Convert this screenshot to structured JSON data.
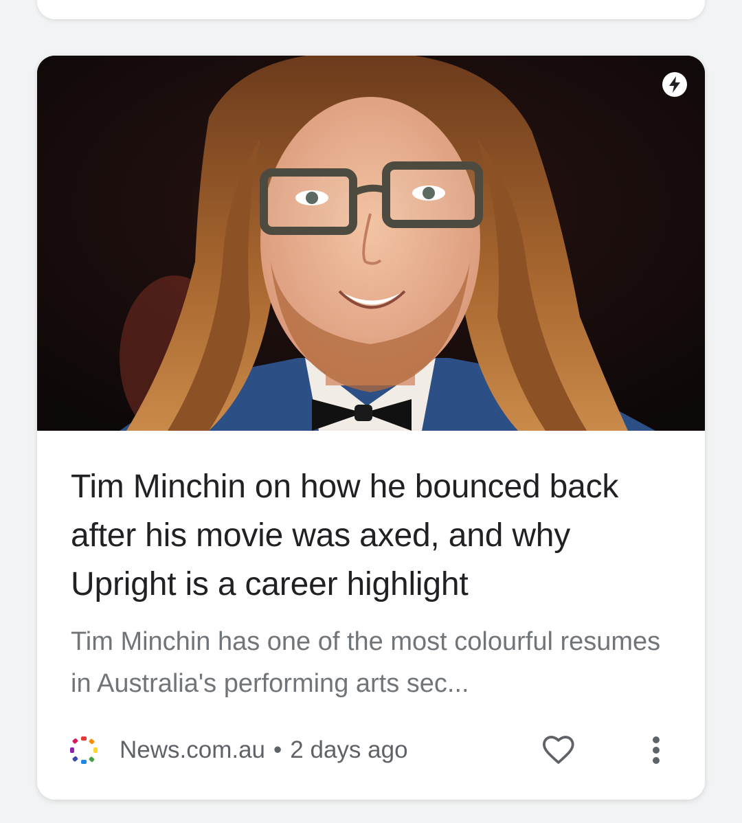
{
  "card": {
    "headline": "Tim Minchin on how he bounced back after his movie was axed, and why Upright is a career highlight",
    "snippet": "Tim Minchin has one of the most colourful resumes in Australia's performing arts sec...",
    "publisher": "News.com.au",
    "separator": "•",
    "time_ago": "2 days ago",
    "amp_icon": "lightning-bolt-icon",
    "like_icon": "heart-outline-icon",
    "more_icon": "more-vertical-icon",
    "publisher_icon": "news-com-au-dots-logo-icon"
  },
  "colors": {
    "headline": "#202124",
    "snippet": "#70757a",
    "meta": "#5f6368",
    "card_bg": "#ffffff",
    "page_bg": "#f1f3f4"
  }
}
